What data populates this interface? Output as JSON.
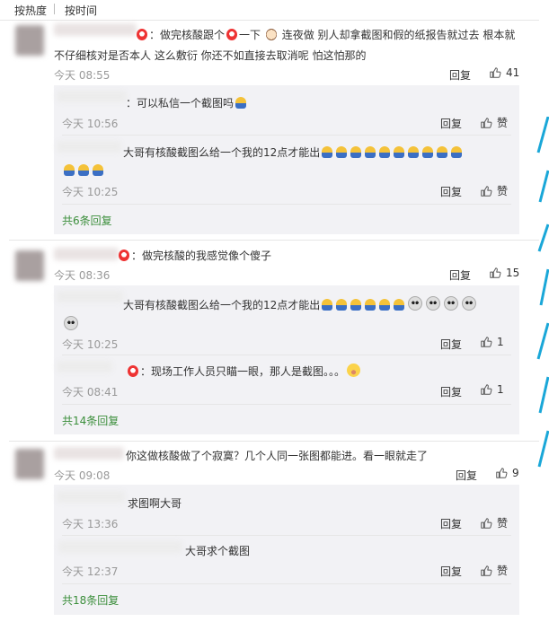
{
  "tabs": {
    "hot": "按热度",
    "time": "按时间"
  },
  "comments": [
    {
      "text1": "：做完核酸跟个",
      "text1b": "一下",
      "text1c": "连夜做 别人却拿截图和假的纸报告就过去  根本就",
      "text2": "不仔细核对是否本人 这么敷衍 你还不如直接去取消呢  怕这怕那的",
      "time": "今天 08:55",
      "reply": "回复",
      "likes": "41",
      "replies": [
        {
          "text": "：可以私信一个截图吗",
          "time": "今天 10:56",
          "reply": "回复",
          "like": "赞"
        },
        {
          "text": "大哥有核酸截图么给一个我的12点才能出",
          "time": "今天 10:25",
          "reply": "回复",
          "like": "赞"
        }
      ],
      "more": "共6条回复"
    },
    {
      "text1": "：做完核酸的我感觉像个傻子",
      "time": "今天 08:36",
      "reply": "回复",
      "likes": "15",
      "replies": [
        {
          "text": "大哥有核酸截图么给一个我的12点才能出",
          "time": "今天 10:25",
          "reply": "回复",
          "like": "1"
        },
        {
          "text": "：现场工作人员只瞄一眼，那人是截图。。。",
          "time": "今天 08:41",
          "reply": "回复",
          "like": "1"
        }
      ],
      "more": "共14条回复"
    },
    {
      "text1": "你这做核酸做了个寂寞？几个人同一张图都能进。看一眼就走了",
      "time": "今天 09:08",
      "reply": "回复",
      "likes": "9",
      "replies": [
        {
          "text": "求图啊大哥",
          "time": "今天 13:36",
          "reply": "回复",
          "like": "赞"
        },
        {
          "text": "大哥求个截图",
          "time": "今天 12:37",
          "reply": "回复",
          "like": "赞"
        }
      ],
      "more": "共18条回复"
    }
  ],
  "colors": {
    "accent_green": "#3b8e3b",
    "sub_bg": "#f2f2f5",
    "muted": "#999999"
  },
  "icons": {
    "like": "thumbs-up-icon"
  }
}
